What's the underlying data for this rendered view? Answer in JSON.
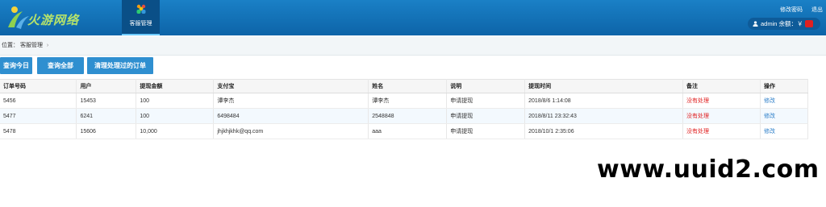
{
  "header": {
    "logo_text": "火游网络",
    "nav_tab_label": "客服管理",
    "link_change_password": "修改密码",
    "link_logout": "退出",
    "user_label": "admin 余额：￥",
    "accent_color": "#0d64a8"
  },
  "breadcrumb": {
    "prefix": "位置：",
    "current": "客服管理"
  },
  "buttons": {
    "today": "查询今日",
    "all": "查询全部",
    "clear": "清理处理过的订单"
  },
  "table": {
    "columns": [
      "订单号码",
      "用户",
      "提现金额",
      "支付宝",
      "姓名",
      "说明",
      "提现时间",
      "备注",
      "操作"
    ],
    "rows": [
      [
        "5456",
        "15453",
        "100",
        "谭李杰",
        "谭李杰",
        "申请提现",
        "2018/8/6 1:14:08",
        "没有处理",
        "修改"
      ],
      [
        "5477",
        "6241",
        "100",
        "6498484",
        "2548848",
        "申请提现",
        "2018/8/11 23:32:43",
        "没有处理",
        "修改"
      ],
      [
        "5478",
        "15606",
        "10,000",
        "jhjkhjkhk@qq.com",
        "aaa",
        "申请提现",
        "2018/10/1 2:35:06",
        "没有处理",
        "修改"
      ]
    ]
  },
  "watermark": "www.uuid2.com"
}
